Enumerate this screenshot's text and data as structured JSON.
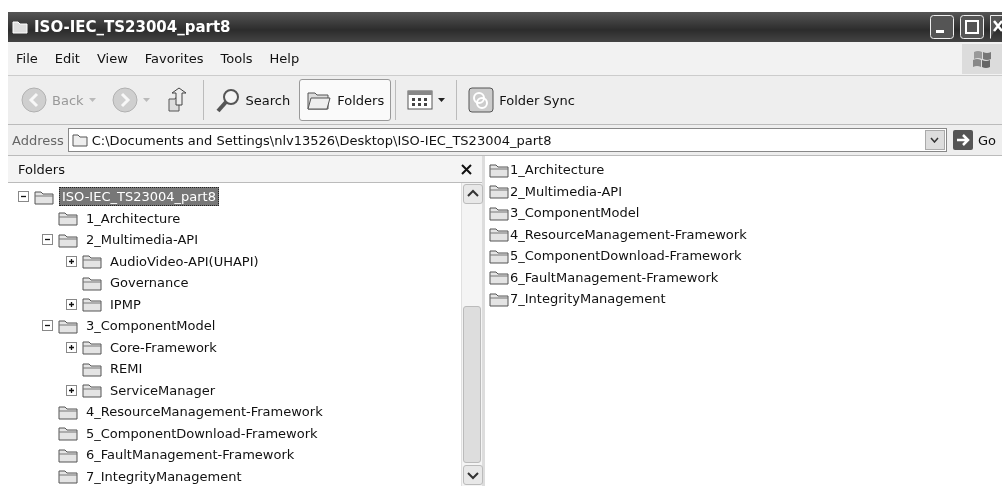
{
  "window": {
    "title": "ISO-IEC_TS23004_part8"
  },
  "menu": [
    "File",
    "Edit",
    "View",
    "Favorites",
    "Tools",
    "Help"
  ],
  "toolbar": [
    {
      "kind": "back",
      "label": "Back",
      "disabled": true,
      "dropdown": true,
      "selected": false
    },
    {
      "kind": "forward",
      "disabled": true,
      "dropdown": true,
      "selected": false
    },
    {
      "kind": "up",
      "selected": false
    },
    {
      "kind": "search",
      "label": "Search",
      "selected": false
    },
    {
      "kind": "folders",
      "label": "Folders",
      "selected": true
    },
    {
      "kind": "views",
      "dropdown": true,
      "selected": false
    },
    {
      "kind": "sync",
      "label": "Folder Sync",
      "selected": false
    }
  ],
  "address": {
    "label": "Address",
    "value": "C:\\Documents and Settings\\nlv13526\\Desktop\\ISO-IEC_TS23004_part8",
    "go": "Go"
  },
  "folders_pane": {
    "title": "Folders",
    "tree": [
      {
        "label": "ISO-IEC_TS23004_part8",
        "selected": true,
        "expanded": true,
        "children": [
          {
            "label": "1_Architecture",
            "selected": false
          },
          {
            "label": "2_Multimedia-API",
            "selected": false,
            "expanded": true,
            "children": [
              {
                "label": "AudioVideo-API(UHAPI)",
                "selected": false,
                "expanded": false
              },
              {
                "label": "Governance",
                "selected": false
              },
              {
                "label": "IPMP",
                "selected": false,
                "expanded": false
              }
            ]
          },
          {
            "label": "3_ComponentModel",
            "selected": false,
            "expanded": true,
            "children": [
              {
                "label": "Core-Framework",
                "selected": false,
                "expanded": false
              },
              {
                "label": "REMI",
                "selected": false
              },
              {
                "label": "ServiceManager",
                "selected": false,
                "expanded": false
              }
            ]
          },
          {
            "label": "4_ResourceManagement-Framework",
            "selected": false
          },
          {
            "label": "5_ComponentDownload-Framework",
            "selected": false
          },
          {
            "label": "6_FaultManagement-Framework",
            "selected": false
          },
          {
            "label": "7_IntegrityManagement",
            "selected": false
          }
        ]
      }
    ]
  },
  "files": [
    "1_Architecture",
    "2_Multimedia-API",
    "3_ComponentModel",
    "4_ResourceManagement-Framework",
    "5_ComponentDownload-Framework",
    "6_FaultManagement-Framework",
    "7_IntegrityManagement"
  ]
}
